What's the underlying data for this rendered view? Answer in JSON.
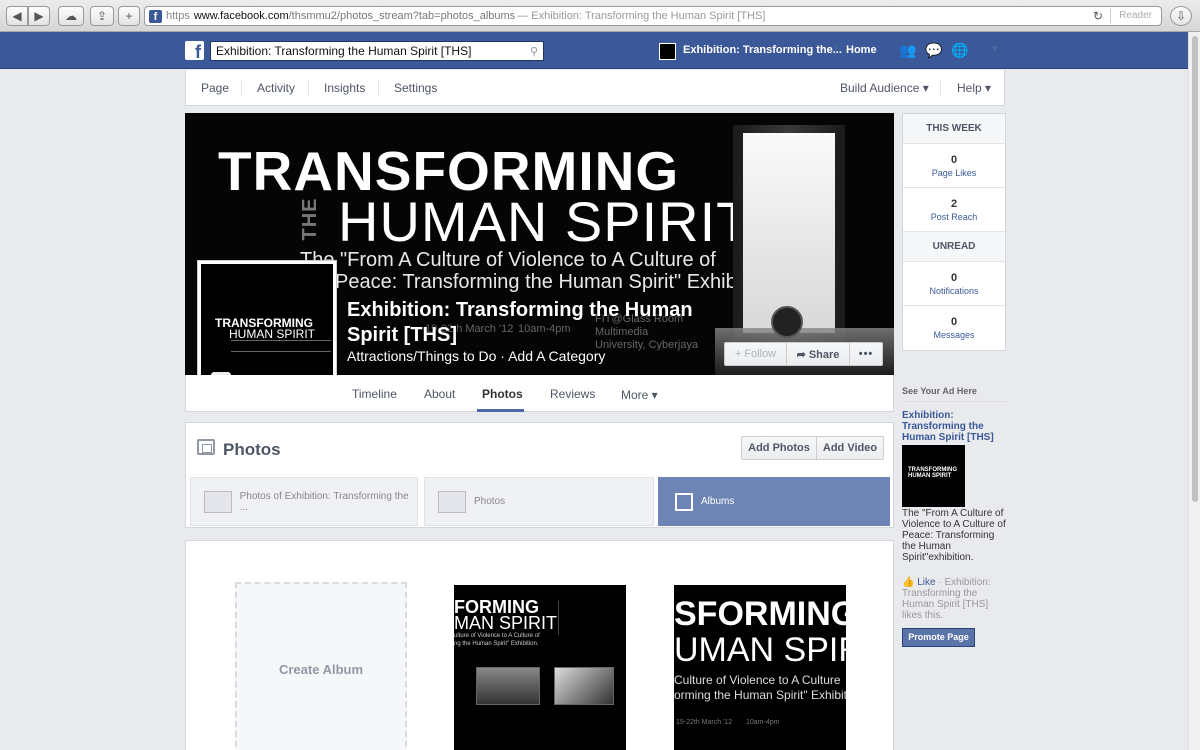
{
  "browser": {
    "url_https": "https",
    "url_domain": "www.facebook.com",
    "url_path": "/thsmmu2/photos_stream?tab=photos_albums",
    "url_title": "— Exhibition: Transforming the Human Spirit [THS]",
    "reader": "Reader"
  },
  "fb_bar": {
    "search_value": "Exhibition: Transforming the Human Spirit [THS]",
    "page_link": "Exhibition: Transforming the...",
    "home": "Home"
  },
  "page_nav": {
    "items": [
      "Page",
      "Activity",
      "Insights",
      "Settings"
    ],
    "build_audience": "Build Audience ▾",
    "help": "Help ▾"
  },
  "cover": {
    "title_line1": "TRANSFORMING",
    "title_the": "THE",
    "title_line2": "HUMAN SPIRIT",
    "sub_line1": "The \"From A Culture of Violence to A Culture of",
    "sub_line2": "Peace: Transforming the Human Spirit\" Exhibition.",
    "info_date": "19-22th March '12",
    "info_time": "10am-4pm",
    "info_venue": "FIT@Glass Room Multimedia University, Cyberjaya"
  },
  "page_info": {
    "name": "Exhibition: Transforming the Human Spirit [THS]",
    "category": "Attractions/Things to Do · Add A Category"
  },
  "cover_actions": {
    "follow": "+ Follow",
    "share": "➦ Share",
    "more": "•••"
  },
  "profile": {
    "line1": "TRANSFORMING",
    "line2": "HUMAN SPIRIT"
  },
  "tabs": {
    "items": [
      "Timeline",
      "About",
      "Photos",
      "Reviews",
      "More ▾"
    ]
  },
  "photos": {
    "title": "Photos",
    "add_photos": "Add Photos",
    "add_video": "Add Video",
    "tab_photos_of": "Photos of Exhibition: Transforming the ...",
    "tab_photos": "Photos",
    "tab_albums": "Albums",
    "create_album": "Create Album"
  },
  "album1": {
    "t1": "FORMING",
    "t2": "MAN SPIRIT",
    "t3": "ulture of Violence to A Culture of",
    "t4": "ng the Human Spirit\" Exhibition."
  },
  "album2": {
    "t1": "SFORMING",
    "t2": "UMAN SPIRI",
    "t3": "Culture of Violence to A Culture",
    "t4": "orming the Human Spirit\" Exhibiti",
    "t5": "19-22th March '12",
    "t6": "10am-4pm"
  },
  "right_col": {
    "this_week": "THIS WEEK",
    "page_likes_num": "0",
    "page_likes_lbl": "Page Likes",
    "post_reach_num": "2",
    "post_reach_lbl": "Post Reach",
    "unread": "UNREAD",
    "notifications_num": "0",
    "notifications_lbl": "Notifications",
    "messages_num": "0",
    "messages_lbl": "Messages"
  },
  "ad": {
    "heading": "See Your Ad Here",
    "title": "Exhibition: Transforming the Human Spirit [THS]",
    "img_text": "TRANSFORMING HUMAN SPIRIT",
    "desc": "The \"From A Culture of Violence to A Culture of Peace: Transforming the Human Spirit\"exhibition.",
    "like": "Like",
    "like_rest": " · Exhibition: Transforming the Human Spirit [THS] likes this.",
    "promote": "Promote Page"
  },
  "colors": {
    "fb_blue": "#3b5998",
    "albums_tab": "#6d84b4"
  }
}
